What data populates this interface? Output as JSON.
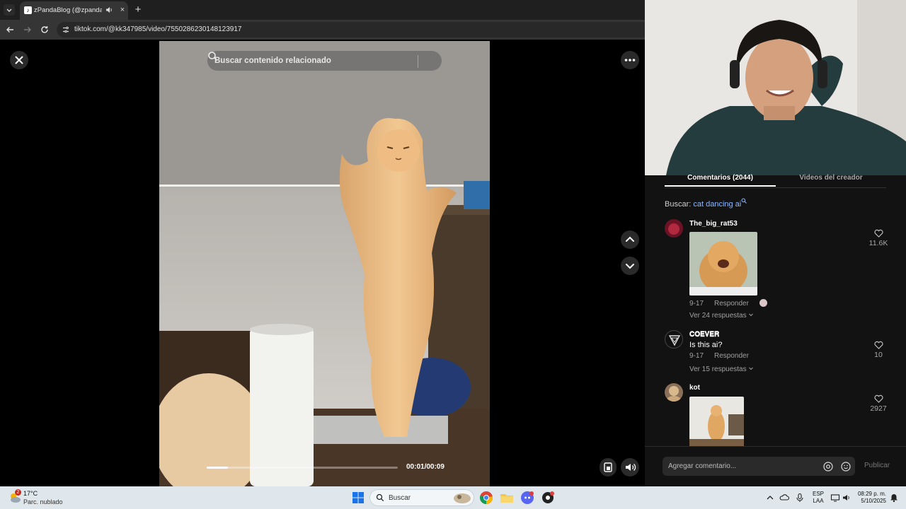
{
  "browser": {
    "tab_title": "zPandaBlog (@zpandablog",
    "tab_favicon": "tiktok-icon",
    "url": "tiktok.com/@kk347985/video/7550286230148123917",
    "new_tab": "+",
    "close_tab": "×"
  },
  "player": {
    "search_placeholder": "Buscar contenido relacionado",
    "time": "00:01/00:09",
    "progress_fraction": 0.11,
    "icons": [
      "close-icon",
      "more-icon",
      "chevron-up-icon",
      "chevron-down-icon",
      "pip-icon",
      "volume-icon",
      "search-icon"
    ]
  },
  "panel": {
    "tab_comments": "Comentarios (2044)",
    "tab_creator_videos": "Videos del creador",
    "search_prefix": "Buscar: ",
    "search_term": "cat dancing ai",
    "comments": [
      {
        "user": "The_big_rat53",
        "text": "",
        "date": "9-17",
        "reply": "Responder",
        "replies": "Ver 24 respuestas",
        "likes": "11.6K"
      },
      {
        "user": "𝐂𝐎𝐄𝐕𝐄𝐑",
        "text": "Is this ai?",
        "date": "9-17",
        "reply": "Responder",
        "replies": "Ver 15 respuestas",
        "likes": "10"
      },
      {
        "user": "kot",
        "text": "",
        "likes": "2927"
      }
    ],
    "composer_placeholder": "Agregar comentario...",
    "publish": "Publicar"
  },
  "taskbar": {
    "temp": "17°C",
    "weather": "Parc. nublado",
    "weather_badge": "2",
    "search": "Buscar",
    "lang_1": "ESP",
    "lang_2": "LAA",
    "time": "08:29 p. m.",
    "date": "5/10/2025"
  },
  "colors": {
    "accent_link": "#8fb8ff",
    "panel_bg": "#121212",
    "taskbar_bg": "#dfe7ec"
  }
}
